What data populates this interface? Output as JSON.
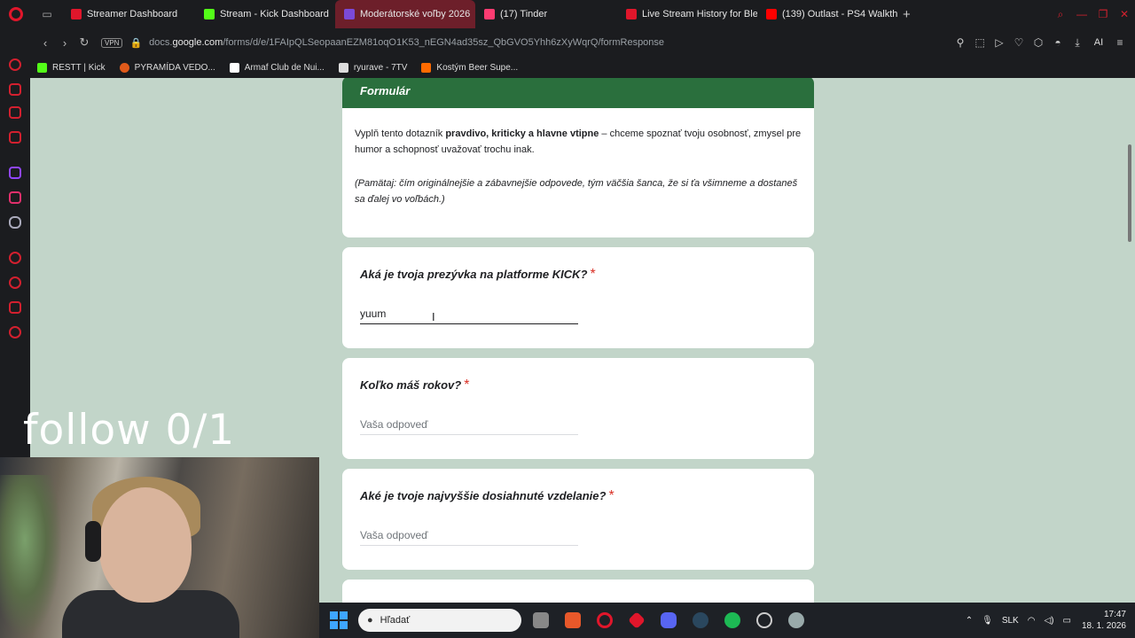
{
  "tabs": [
    {
      "title": "Streamer Dashboard",
      "color": "#e0162b",
      "active": false
    },
    {
      "title": "Stream - Kick Dashboard",
      "color": "#53fc18",
      "active": false
    },
    {
      "title": "Moderátorské voľby 2026",
      "color": "#7b4ad8",
      "active": true
    },
    {
      "title": "(17) Tinder",
      "color": "#fe3c72",
      "active": false
    },
    {
      "title": "Live Stream History for Ble",
      "color": "#e0162b",
      "active": false
    },
    {
      "title": "(139) Outlast - PS4 Walkth",
      "color": "#ff0000",
      "active": false
    }
  ],
  "address": {
    "vpn": "VPN",
    "url_prefix": "docs.",
    "url_domain": "google.com",
    "url_rest": "/forms/d/e/1FAIpQLSeopaanEZM81oqO1K53_nEGN4ad35sz_QbGVO5Yhh6zXyWqrQ/formResponse",
    "ai_label": "AI"
  },
  "bookmarks": [
    {
      "label": "RESTT | Kick",
      "color": "#53fc18"
    },
    {
      "label": "PYRAMÍDA VEDO...",
      "color": "#e05a1a"
    },
    {
      "label": "Armaf Club de Nui...",
      "color": "#1b1c1f"
    },
    {
      "label": "ryurave - 7TV",
      "color": "#1b1c1f"
    },
    {
      "label": "Kostým Beer Supe...",
      "color": "#ff6a00"
    }
  ],
  "form": {
    "section_title": "Formulár",
    "desc_part1": "Vyplň tento dotazník ",
    "desc_bold": "pravdivo, kriticky a hlavne vtipne",
    "desc_part2": " – chceme spoznať tvoju osobnosť, zmysel pre humor a schopnosť uvažovať trochu inak.",
    "note": "(Pamätaj: čím originálnejšie a zábavnejšie odpovede, tým väčšia šanca, že si ťa všimneme a dostaneš sa ďalej vo voľbách.)",
    "questions": [
      {
        "title": "Aká je tvoja prezývka na platforme KICK?",
        "answer": "yuum",
        "placeholder": ""
      },
      {
        "title": "Koľko máš rokov?",
        "answer": "",
        "placeholder": "Vaša odpoveď"
      },
      {
        "title": "Aké je tvoje najvyššie dosiahnuté vzdelanie?",
        "answer": "",
        "placeholder": "Vaša odpoveď"
      }
    ],
    "required_mark": "*"
  },
  "overlay_text": "follow 0/1",
  "taskbar": {
    "search_placeholder": "Hľadať",
    "language": "SLK",
    "time": "17:47",
    "date": "18. 1. 2026"
  }
}
